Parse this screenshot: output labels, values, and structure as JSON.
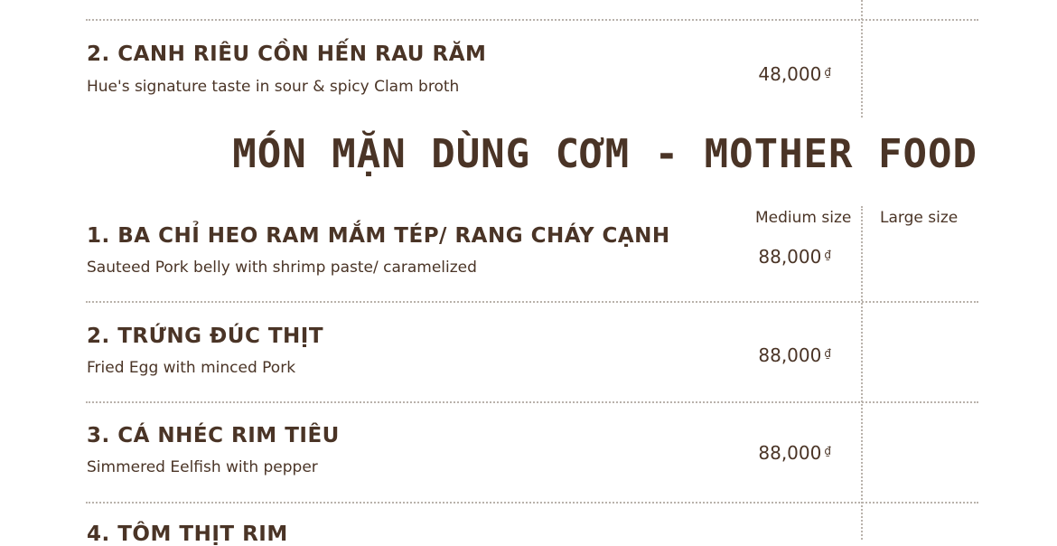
{
  "previous_section": {
    "items": [
      {
        "name": "2. CANH RIÊU CỒN HẾN RAU RĂM",
        "description": "Hue's signature taste in sour & spicy Clam broth",
        "price": "48,000",
        "currency": "₫"
      }
    ]
  },
  "section": {
    "title": "MÓN MẶN DÙNG CƠM - MOTHER FOOD",
    "column_headers": {
      "medium": "Medium size",
      "large": "Large size"
    },
    "items": [
      {
        "name": "1. BA CHỈ HEO RAM MẮM TÉP/ RANG CHÁY CẠNH",
        "description": "Sauteed Pork belly with shrimp paste/ caramelized",
        "price": "88,000",
        "currency": "₫"
      },
      {
        "name": "2. TRỨNG ĐÚC THỊT",
        "description": "Fried Egg with minced Pork",
        "price": "88,000",
        "currency": "₫"
      },
      {
        "name": "3. CÁ NHÉC RIM TIÊU",
        "description": "Simmered Eelfish with pepper",
        "price": "88,000",
        "currency": "₫"
      },
      {
        "name": "4. TÔM THỊT RIM"
      }
    ]
  }
}
